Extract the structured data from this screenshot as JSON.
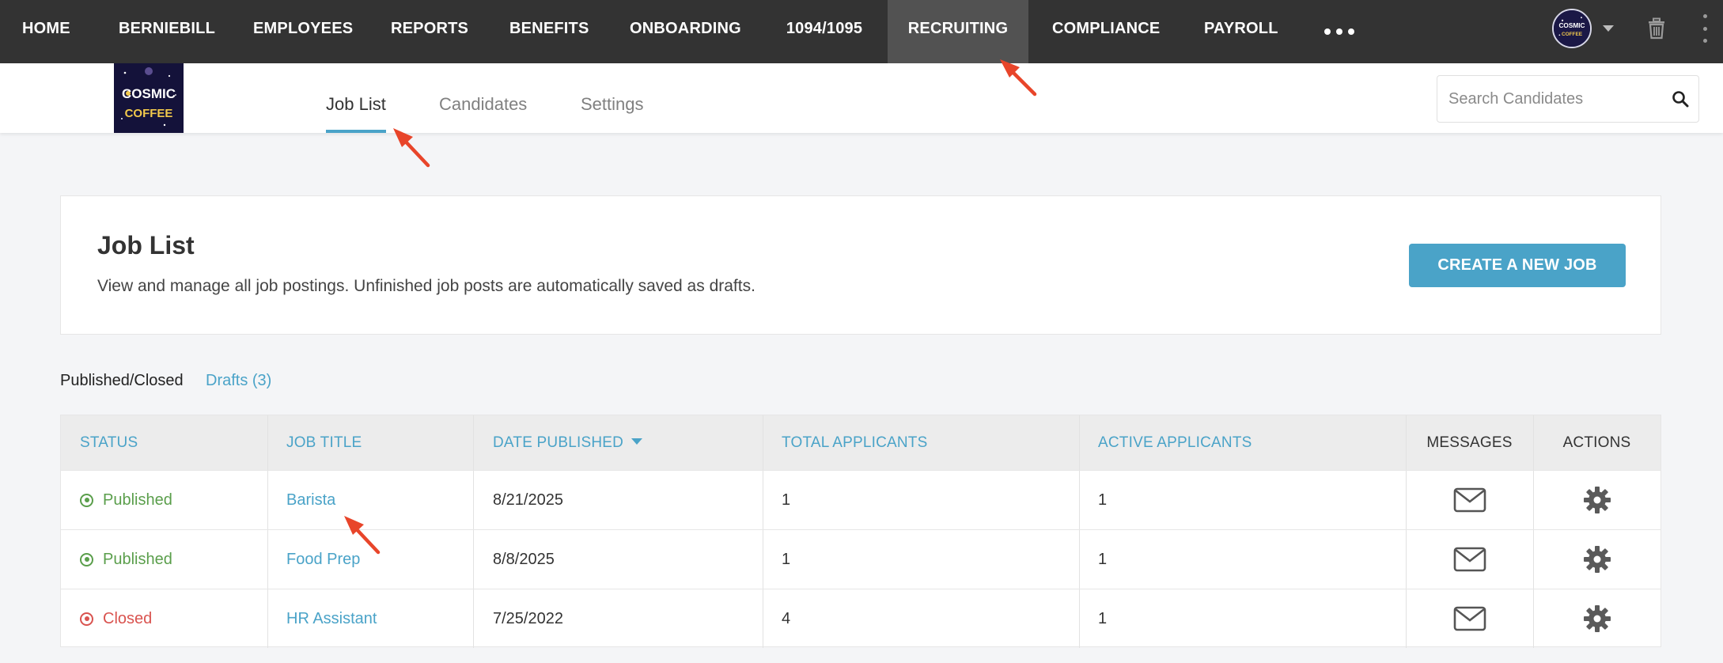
{
  "nav": {
    "items": [
      {
        "label": "HOME"
      },
      {
        "label": "BERNIEBILL"
      },
      {
        "label": "EMPLOYEES"
      },
      {
        "label": "REPORTS"
      },
      {
        "label": "BENEFITS"
      },
      {
        "label": "ONBOARDING"
      },
      {
        "label": "1094/1095"
      },
      {
        "label": "RECRUITING",
        "active": true
      },
      {
        "label": "COMPLIANCE"
      },
      {
        "label": "PAYROLL"
      }
    ],
    "avatar_text": [
      "COSMIC",
      "COFFEE"
    ]
  },
  "logo": {
    "line1": "COSMIC",
    "line2": "COFFEE"
  },
  "subtabs": [
    {
      "label": "Job List",
      "active": true
    },
    {
      "label": "Candidates"
    },
    {
      "label": "Settings"
    }
  ],
  "search": {
    "placeholder": "Search Candidates",
    "value": ""
  },
  "card": {
    "title": "Job List",
    "description": "View and manage all job postings. Unfinished job posts are automatically saved as drafts.",
    "create_button": "CREATE A NEW JOB"
  },
  "filters": {
    "published_closed": "Published/Closed",
    "drafts": "Drafts (3)"
  },
  "table": {
    "headers": {
      "status": "STATUS",
      "job_title": "JOB TITLE",
      "date_published": "DATE PUBLISHED",
      "total_applicants": "TOTAL APPLICANTS",
      "active_applicants": "ACTIVE APPLICANTS",
      "messages": "MESSAGES",
      "actions": "ACTIONS"
    },
    "rows": [
      {
        "status": "Published",
        "job_title": "Barista",
        "date_published": "8/21/2025",
        "total_applicants": "1",
        "active_applicants": "1"
      },
      {
        "status": "Published",
        "job_title": "Food Prep",
        "date_published": "8/8/2025",
        "total_applicants": "1",
        "active_applicants": "1"
      },
      {
        "status": "Closed",
        "job_title": "HR Assistant",
        "date_published": "7/25/2022",
        "total_applicants": "4",
        "active_applicants": "1"
      }
    ]
  },
  "colors": {
    "nav_bg": "#333333",
    "nav_active": "#525252",
    "accent": "#4aa3c8",
    "published": "#5a9e4b",
    "closed": "#d9534f",
    "annotation_arrow": "#e8452a"
  },
  "icons": [
    "search-icon",
    "envelope-icon",
    "gear-icon",
    "trash-icon",
    "caret-down-icon",
    "more-horizontal-icon",
    "more-vertical-icon"
  ]
}
